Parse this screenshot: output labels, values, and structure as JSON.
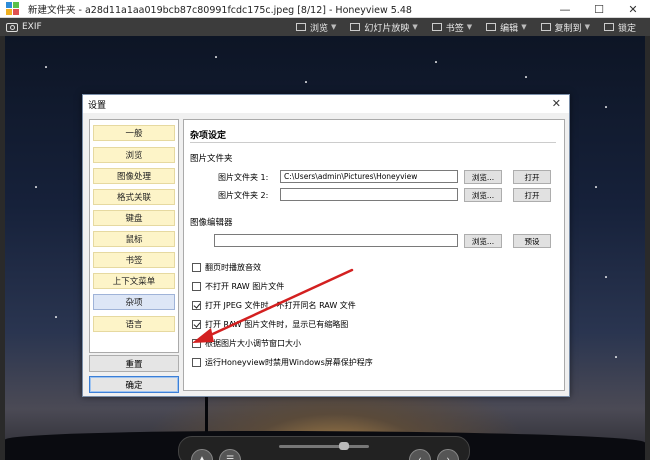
{
  "window": {
    "title": "新建文件夹 - a28d11a1aa019bcb87c80991fcdc175c.jpeg [8/12] - Honeyview 5.48",
    "minimize": "—",
    "maximize": "☐",
    "close": "✕"
  },
  "toolbar": {
    "exif_label": "EXIF",
    "items": [
      {
        "label": "浏览",
        "icon": "browse-icon"
      },
      {
        "label": "幻灯片放映",
        "icon": "slideshow-icon"
      },
      {
        "label": "书签",
        "icon": "bookmark-icon"
      },
      {
        "label": "编辑",
        "icon": "edit-icon"
      },
      {
        "label": "复制到",
        "icon": "copy-icon"
      },
      {
        "label": "锁定",
        "icon": "lock-icon"
      }
    ]
  },
  "dialog": {
    "title": "设置",
    "close": "✕",
    "sidebar": [
      {
        "label": "一般"
      },
      {
        "label": "浏览"
      },
      {
        "label": "图像处理"
      },
      {
        "label": "格式关联"
      },
      {
        "label": "键盘"
      },
      {
        "label": "鼠标"
      },
      {
        "label": "书签"
      },
      {
        "label": "上下文菜单"
      },
      {
        "label": "杂项"
      },
      {
        "label": "语言"
      }
    ],
    "active_item": "杂项",
    "reset_button": "重置",
    "ok_button": "确定",
    "section_title": "杂项设定",
    "image_folder": {
      "group_label": "图片文件夹",
      "folder1_label": "图片文件夹 1:",
      "folder1_value": "C:\\Users\\admin\\Pictures\\Honeyview",
      "folder2_label": "图片文件夹 2:",
      "folder2_value": "",
      "browse_label": "浏览...",
      "open_label": "打开"
    },
    "image_editor": {
      "group_label": "图像编辑器",
      "editor_value": "",
      "browse_label": "浏览...",
      "preset_label": "预设"
    },
    "checkboxes": [
      {
        "label": "翻页时播放音效",
        "checked": false
      },
      {
        "label": "不打开 RAW 图片文件",
        "checked": false
      },
      {
        "label": "打开 JPEG 文件时，不打开同名 RAW 文件",
        "checked": true
      },
      {
        "label": "打开 RAW 图片文件时，显示已有缩略图",
        "checked": true
      },
      {
        "label": "根据图片大小调节窗口大小",
        "checked": false
      },
      {
        "label": "运行Honeyview时禁用Windows屏幕保护程序",
        "checked": false
      }
    ]
  },
  "colors": {
    "annotation_arrow": "#d32020",
    "sidebar_item_bg": "#fdf4c8",
    "sidebar_active_bg": "#dde6f6",
    "toolbar_bg": "#3c3c3c"
  }
}
